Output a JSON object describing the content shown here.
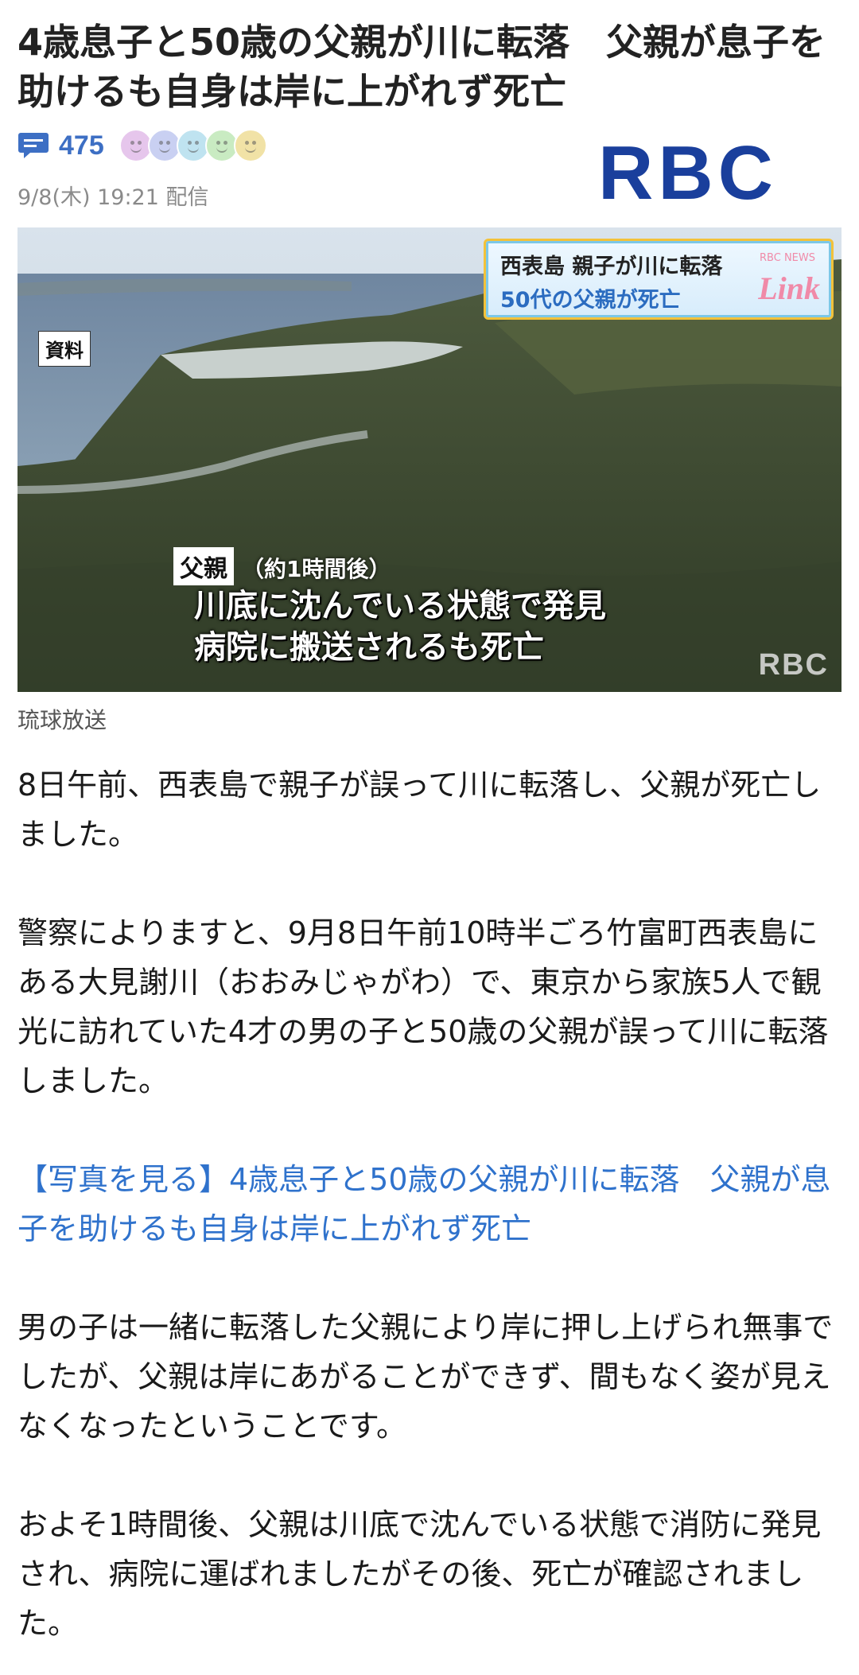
{
  "article": {
    "headline": "4歳息子と50歳の父親が川に転落　父親が息子を助けるも自身は岸に上がれず死亡",
    "comment_count": "475",
    "date": "9/8(木) 19:21 配信",
    "source_logo_text": "RBC",
    "image": {
      "tag": "資料",
      "banner_line1": "西表島 親子が川に転落",
      "banner_line2": "50代の父親が死亡",
      "banner_brand": "Link",
      "banner_brand_small": "RBC NEWS",
      "caption_label": "父親",
      "caption_note": "（約1時間後）",
      "caption_line1": "川底に沈んでいる状態で発見",
      "caption_line2": "病院に搬送されるも死亡",
      "watermark": "RBC"
    },
    "image_credit": "琉球放送",
    "paragraphs": [
      "8日午前、西表島で親子が誤って川に転落し、父親が死亡しました。",
      "警察によりますと、9月8日午前10時半ごろ竹富町西表島にある大見謝川（おおみじゃがわ）で、東京から家族5人で観光に訪れていた4才の男の子と50歳の父親が誤って川に転落しました。",
      "【写真を見る】4歳息子と50歳の父親が川に転落　父親が息子を助けるも自身は岸に上がれず死亡",
      "男の子は一緒に転落した父親により岸に押し上げられ無事でしたが、父親は岸にあがることができず、間もなく姿が見えなくなったということです。",
      "およそ1時間後、父親は川底で沈んでいる状態で消防に発見され、病院に運ばれましたがその後、死亡が確認されました。"
    ]
  },
  "colors": {
    "link": "#2f72cc",
    "comment_accent": "#3d6fc4",
    "logo_blue": "#1a3f9c",
    "reaction_faces": [
      "#e6c6ec",
      "#c9d0f2",
      "#bfe3f0",
      "#c9ebc2",
      "#f1e2a6"
    ]
  },
  "icons": {
    "comment": "speech-bubble-icon",
    "reactions": "face-icons"
  }
}
